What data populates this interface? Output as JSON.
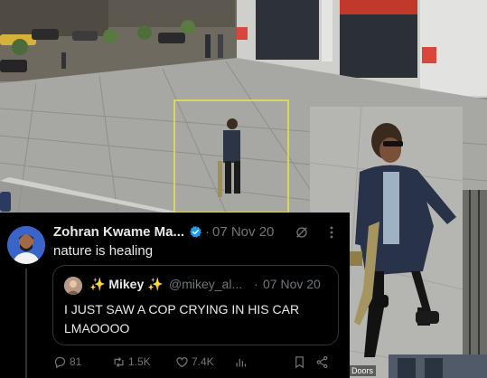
{
  "camera": {
    "label": "Doors"
  },
  "tweet": {
    "author": {
      "display_name": "Zohran Kwame Ma...",
      "verified": true
    },
    "separator": "·",
    "date": "07 Nov 20",
    "text": "nature is healing",
    "quoted": {
      "display_name": "✨ Mikey ✨",
      "handle": "@mikey_al...",
      "separator": "·",
      "date": "07 Nov 20",
      "text": "I JUST SAW A COP CRYING IN HIS CAR LMAOOOO"
    },
    "actions": {
      "replies": "81",
      "retweets": "1.5K",
      "likes": "7.4K"
    }
  },
  "colors": {
    "background": "#000000",
    "text_primary": "#e7e9ea",
    "text_secondary": "#71767b",
    "verified_badge": "#1d9bf0",
    "border": "#2f3336",
    "detection_box": "#e6e64a"
  },
  "icons": [
    "verified-badge-icon",
    "grok-icon",
    "more-icon",
    "reply-icon",
    "retweet-icon",
    "like-icon",
    "views-icon",
    "bookmark-icon",
    "share-icon"
  ]
}
